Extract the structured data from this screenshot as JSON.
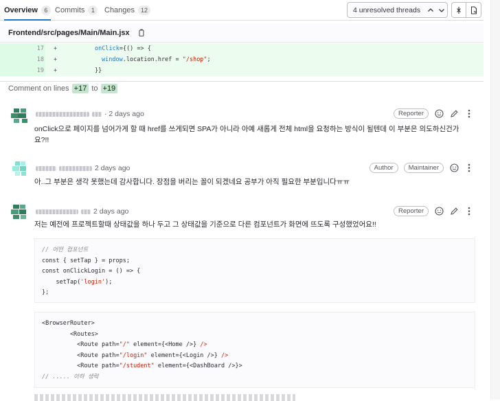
{
  "tabs": [
    {
      "label": "Overview",
      "count": "6"
    },
    {
      "label": "Commits",
      "count": "1"
    },
    {
      "label": "Changes",
      "count": "12"
    }
  ],
  "threads": {
    "label": "4 unresolved threads"
  },
  "file": {
    "path": "Frontend/src/pages/Main/Main.jsx"
  },
  "diff": [
    {
      "line": "17",
      "sign": "+"
    },
    {
      "line": "18",
      "sign": "+"
    },
    {
      "line": "19",
      "sign": "+"
    }
  ],
  "comment_on": {
    "prefix": "Comment on lines",
    "from": "+17",
    "to_word": "to",
    "to": "+19"
  },
  "notes": [
    {
      "time": "· 2 days ago",
      "roles": [
        "Reporter"
      ],
      "body": "onClick으로 페이지를 넘어가게 할 때 href를 쓰게되면 SPA가 아니라 아예 새롭게 전체 html을 요청하는 방식이 될텐데 이 부분은 의도하신건가요?!!"
    },
    {
      "time": "2 days ago",
      "roles": [
        "Author",
        "Maintainer"
      ],
      "body": "아..그 부분은 생각 못했는데 감사합니다. 장점을 버리는 꼴이 되겠네요 공부가 아직 필요한 부분입니다ㅠㅠ"
    },
    {
      "time": "2 days ago",
      "roles": [
        "Reporter"
      ],
      "body": "저는 예전에 프로젝트할때 상태값을 하나 두고 그 상태값을 기준으로 다른 컴포넌트가 화면에 뜨도록 구성했었어요!!"
    }
  ]
}
